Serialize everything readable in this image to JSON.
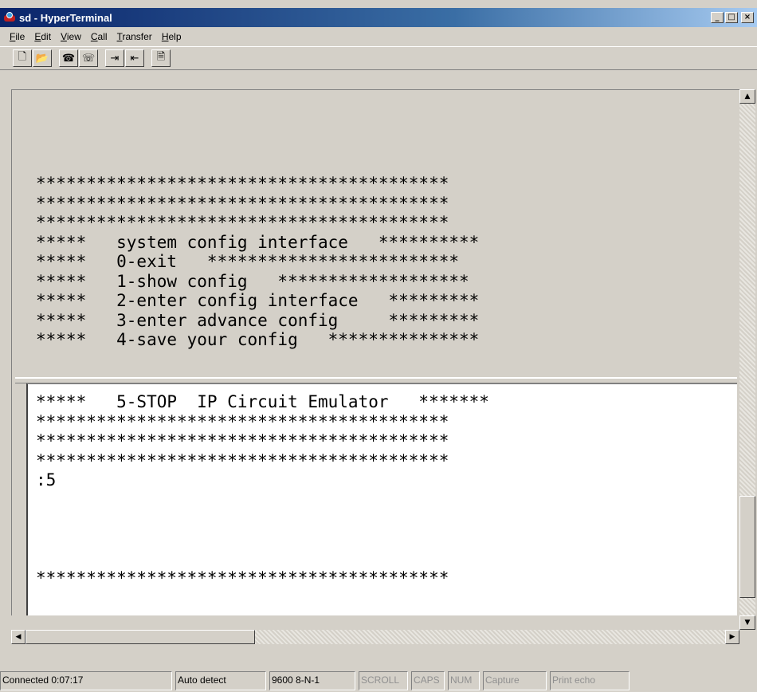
{
  "window": {
    "title": "sd - HyperTerminal",
    "minimize_label": "_",
    "maximize_label": "□",
    "close_label": "×"
  },
  "menu": [
    {
      "label": "File",
      "mnemonic": "F",
      "rest": "ile"
    },
    {
      "label": "Edit",
      "mnemonic": "E",
      "rest": "dit"
    },
    {
      "label": "View",
      "mnemonic": "V",
      "rest": "iew"
    },
    {
      "label": "Call",
      "mnemonic": "C",
      "rest": "all"
    },
    {
      "label": "Transfer",
      "mnemonic": "T",
      "rest": "ransfer"
    },
    {
      "label": "Help",
      "mnemonic": "H",
      "rest": "elp"
    }
  ],
  "toolbar": {
    "icons": [
      "new-document-icon",
      "open-folder-icon",
      "call-phone-icon",
      "disconnect-phone-icon",
      "send-file-icon",
      "receive-file-icon",
      "properties-icon"
    ],
    "glyphs": [
      "🗋",
      "📂",
      "☎",
      "☏",
      "⇥",
      "⇤",
      "🗎"
    ]
  },
  "terminal": {
    "backscroll_lines": [
      "*****************************************",
      "*****************************************",
      "*****************************************",
      "*****   system config interface   **********",
      "*****   0-exit   *************************",
      "*****   1-show config   *******************",
      "*****   2-enter config interface   *********",
      "*****   3-enter advance config     *********",
      "*****   4-save your config   ***************"
    ],
    "live_lines": [
      "*****   5-STOP  IP Circuit Emulator   *******",
      "*****************************************",
      "*****************************************",
      "*****************************************",
      ":5",
      "",
      "",
      "",
      "",
      "*****************************************"
    ]
  },
  "scrollbar": {
    "up_arrow": "▲",
    "down_arrow": "▼",
    "left_arrow": "◀",
    "right_arrow": "▶"
  },
  "status": {
    "connected": "Connected 0:07:17",
    "detect": "Auto detect",
    "settings": "9600 8-N-1",
    "scroll": "SCROLL",
    "caps": "CAPS",
    "num": "NUM",
    "capture": "Capture",
    "print_echo": "Print echo"
  }
}
